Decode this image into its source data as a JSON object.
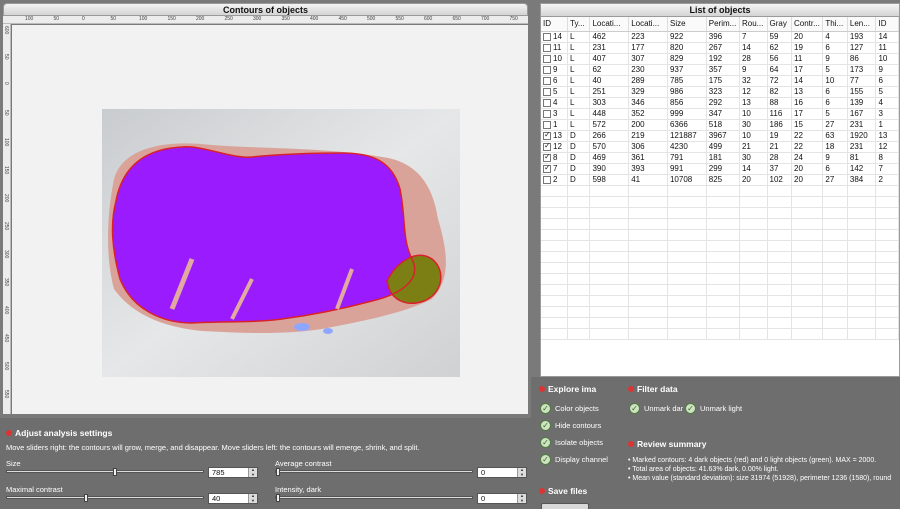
{
  "contours_panel": {
    "title": "Contours of objects",
    "ruler_top": [
      "100",
      "50",
      "0",
      "50",
      "100",
      "150",
      "200",
      "250",
      "300",
      "350",
      "400",
      "450",
      "500",
      "550",
      "600",
      "650",
      "700",
      "750"
    ],
    "ruler_left": [
      "600",
      "50",
      "0",
      "50",
      "100",
      "150",
      "200",
      "250",
      "300",
      "350",
      "400",
      "450",
      "500",
      "550"
    ]
  },
  "list_panel": {
    "title": "List of objects",
    "columns": [
      "ID",
      "Ty...",
      "Locati...",
      "Locati...",
      "Size",
      "Perim...",
      "Rou...",
      "Gray",
      "Contr...",
      "Thi...",
      "Len...",
      "ID"
    ],
    "rows": [
      {
        "checked": false,
        "cells": [
          "14",
          "L",
          "462",
          "223",
          "922",
          "396",
          "7",
          "59",
          "20",
          "4",
          "193",
          "14"
        ]
      },
      {
        "checked": false,
        "cells": [
          "11",
          "L",
          "231",
          "177",
          "820",
          "267",
          "14",
          "62",
          "19",
          "6",
          "127",
          "11"
        ]
      },
      {
        "checked": false,
        "cells": [
          "10",
          "L",
          "407",
          "307",
          "829",
          "192",
          "28",
          "56",
          "11",
          "9",
          "86",
          "10"
        ]
      },
      {
        "checked": false,
        "cells": [
          "9",
          "L",
          "62",
          "230",
          "937",
          "357",
          "9",
          "64",
          "17",
          "5",
          "173",
          "9"
        ]
      },
      {
        "checked": false,
        "cells": [
          "6",
          "L",
          "40",
          "289",
          "785",
          "175",
          "32",
          "72",
          "14",
          "10",
          "77",
          "6"
        ]
      },
      {
        "checked": false,
        "cells": [
          "5",
          "L",
          "251",
          "329",
          "986",
          "323",
          "12",
          "82",
          "13",
          "6",
          "155",
          "5"
        ]
      },
      {
        "checked": false,
        "cells": [
          "4",
          "L",
          "303",
          "346",
          "856",
          "292",
          "13",
          "88",
          "16",
          "6",
          "139",
          "4"
        ]
      },
      {
        "checked": false,
        "cells": [
          "3",
          "L",
          "448",
          "352",
          "999",
          "347",
          "10",
          "116",
          "17",
          "5",
          "167",
          "3"
        ]
      },
      {
        "checked": false,
        "cells": [
          "1",
          "L",
          "572",
          "200",
          "6366",
          "518",
          "30",
          "186",
          "15",
          "27",
          "231",
          "1"
        ]
      },
      {
        "checked": true,
        "cells": [
          "13",
          "D",
          "266",
          "219",
          "121887",
          "3967",
          "10",
          "19",
          "22",
          "63",
          "1920",
          "13"
        ]
      },
      {
        "checked": true,
        "cells": [
          "12",
          "D",
          "570",
          "306",
          "4230",
          "499",
          "21",
          "21",
          "22",
          "18",
          "231",
          "12"
        ]
      },
      {
        "checked": true,
        "cells": [
          "8",
          "D",
          "469",
          "361",
          "791",
          "181",
          "30",
          "28",
          "24",
          "9",
          "81",
          "8"
        ]
      },
      {
        "checked": true,
        "cells": [
          "7",
          "D",
          "390",
          "393",
          "991",
          "299",
          "14",
          "37",
          "20",
          "6",
          "142",
          "7"
        ]
      },
      {
        "checked": false,
        "cells": [
          "2",
          "D",
          "598",
          "41",
          "10708",
          "825",
          "20",
          "102",
          "20",
          "27",
          "384",
          "2"
        ]
      }
    ]
  },
  "analysis": {
    "heading": "Adjust analysis settings",
    "hint": "Move sliders right: the contours will grow, merge, and disappear. Move sliders left: the contours will emerge, shrink, and split.",
    "size_label": "Size",
    "size_value": "785",
    "size_level": 0.55,
    "avg_contrast_label": "Average contrast",
    "avg_contrast_value": "0",
    "avg_contrast_level": 0.0,
    "max_contrast_label": "Maximal contrast",
    "max_contrast_value": "40",
    "max_contrast_level": 0.4,
    "intensity_label": "Intensity, dark",
    "intensity_value": "0",
    "intensity_level": 0.0
  },
  "explore": {
    "heading": "Explore ima",
    "buttons": [
      "Color objects",
      "Hide contours",
      "Isolate objects",
      "Display channel"
    ]
  },
  "filter": {
    "heading": "Filter data",
    "unmark_dark": "Unmark dar",
    "unmark_light": "Unmark light"
  },
  "review": {
    "heading": "Review summary",
    "lines": [
      "• Marked contours: 4 dark objects (red) and 0 light objects (green). MAX = 2000.",
      "• Total area of objects: 41.63% dark, 0.00% light.",
      "• Mean value (standard deviation): size 31974 (51928), perimeter 1236 (1580), round"
    ]
  },
  "save": {
    "heading": "Save files"
  },
  "colors": {
    "dark_object": "#9b1bff",
    "light_object": "#7c7f14",
    "contour": "#d8222a",
    "background": "#7a7a7a"
  }
}
